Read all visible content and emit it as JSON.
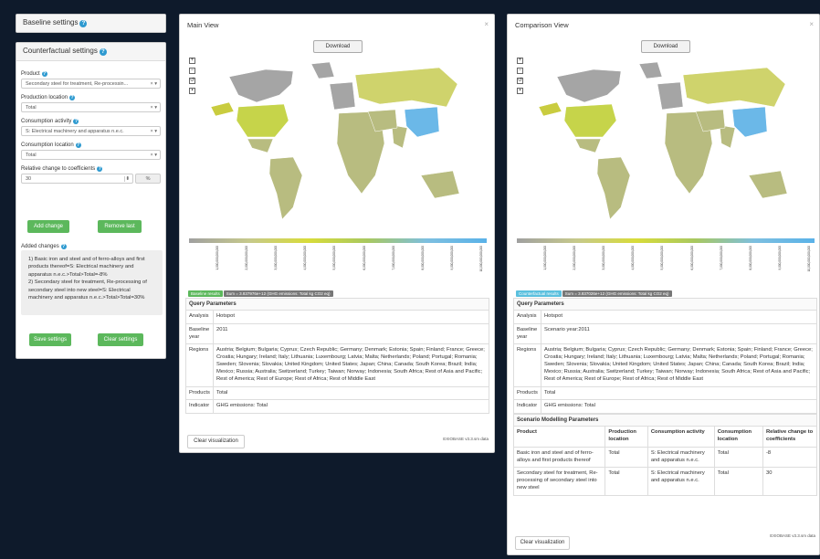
{
  "baseline_settings": {
    "title": "Baseline settings"
  },
  "counterfactual": {
    "title": "Counterfactual settings",
    "product_label": "Product",
    "product_value": "Secondary steel for treatment, Re-processin...",
    "prodloc_label": "Production location",
    "prodloc_value": "Total",
    "consact_label": "Consumption activity",
    "consact_value": "S: Electrical machinery and apparatus n.e.c.",
    "consloc_label": "Consumption location",
    "consloc_value": "Total",
    "rel_label": "Relative change to coefficients",
    "rel_value": "30",
    "rel_unit": "%",
    "add_btn": "Add change",
    "remove_btn": "Remove last",
    "added_label": "Added changes",
    "added_text": "1) Basic iron and steel and of ferro-alloys and first products thereof=S: Electrical machinery and apparatus n.e.c.>Total>Total=-8%\n2) Secondary steel for treatment, Re-processing of secondary steel into new steel=S: Electrical machinery and apparatus n.e.c.>Total>Total=30%",
    "save_btn": "Save settings",
    "clear_btn": "Clear settings"
  },
  "main_view": {
    "title": "Main View",
    "download": "Download",
    "badge1": "Baseline results",
    "badge2": "Sum = 3.837976e+12 (GHG emissions: Total kg CO2 eq)",
    "qp_title": "Query Parameters",
    "rows": [
      {
        "k": "Analysis",
        "v": "Hotspot"
      },
      {
        "k": "Baseline year",
        "v": "2011"
      },
      {
        "k": "Regions",
        "v": "Austria; Belgium; Bulgaria; Cyprus; Czech Republic; Germany; Denmark; Estonia; Spain; Finland; France; Greece; Croatia; Hungary; Ireland; Italy; Lithuania; Luxembourg; Latvia; Malta; Netherlands; Poland; Portugal; Romania; Sweden; Slovenia; Slovakia; United Kingdom; United States; Japan; China; Canada; South Korea; Brazil; India; Mexico; Russia; Australia; Switzerland; Turkey; Taiwan; Norway; Indonesia; South Africa; Rest of Asia and Pacific; Rest of America; Rest of Europe; Rest of Africa; Rest of Middle East"
      },
      {
        "k": "Products",
        "v": "Total"
      },
      {
        "k": "Indicator",
        "v": "GHG emissions: Total"
      }
    ],
    "clear_vis": "Clear visualization",
    "footer": "EXIOBASE v3.3.sm data"
  },
  "comparison_view": {
    "title": "Comparison View",
    "download": "Download",
    "badge1": "Counterfactual results",
    "badge2": "Sum = 3.837026e+12 (GHG emissions: Total kg CO2 eq)",
    "qp_title": "Query Parameters",
    "rows": [
      {
        "k": "Analysis",
        "v": "Hotspot"
      },
      {
        "k": "Baseline year",
        "v": "Scenario year:2011"
      },
      {
        "k": "Regions",
        "v": "Austria; Belgium; Bulgaria; Cyprus; Czech Republic; Germany; Denmark; Estonia; Spain; Finland; France; Greece; Croatia; Hungary; Ireland; Italy; Lithuania; Luxembourg; Latvia; Malta; Netherlands; Poland; Portugal; Romania; Sweden; Slovenia; Slovakia; United Kingdom; United States; Japan; China; Canada; South Korea; Brazil; India; Mexico; Russia; Australia; Switzerland; Turkey; Taiwan; Norway; Indonesia; South Africa; Rest of Asia and Pacific; Rest of America; Rest of Europe; Rest of Africa; Rest of Middle East"
      },
      {
        "k": "Products",
        "v": "Total"
      },
      {
        "k": "Indicator",
        "v": "GHG emissions: Total"
      }
    ],
    "smp_title": "Scenario Modelling Parameters",
    "smp_headers": [
      "Product",
      "Production location",
      "Consumption activity",
      "Consumption location",
      "Relative change to coefficients"
    ],
    "smp_rows": [
      [
        "Basic iron and steel and of ferro-alloys and first products thereof",
        "Total",
        "S: Electrical machinery and apparatus n.e.c.",
        "Total",
        "-8"
      ],
      [
        "Secondary steel for treatment, Re-processing of secondary steel into new steel",
        "Total",
        "S: Electrical machinery and apparatus n.e.c.",
        "Total",
        "30"
      ]
    ],
    "clear_vis": "Clear visualization",
    "footer": "EXIOBASE v3.3.sm data"
  },
  "legend_ticks": [
    "1,000,000,000,000",
    "2,000,000,000,000",
    "3,000,000,000,000",
    "4,000,000,000,000",
    "5,000,000,000,000",
    "6,000,000,000,000",
    "7,000,000,000,000",
    "8,000,000,000,000",
    "9,000,000,000,000",
    "10,000,000,000,000"
  ],
  "colors": {
    "accent": "#2e9ad0",
    "green": "#5cb85c",
    "badge_baseline": "#5cb85c",
    "badge_cf": "#5bc0de",
    "badge_sum": "#777777",
    "bg": "#0e1a2b"
  }
}
